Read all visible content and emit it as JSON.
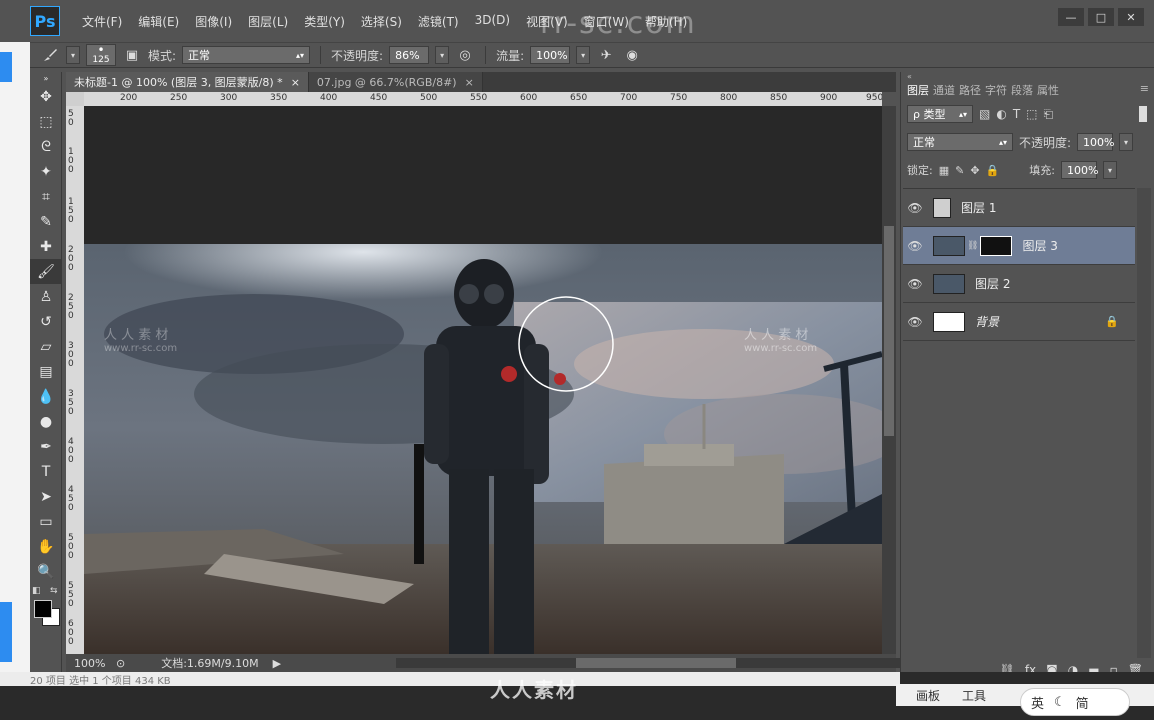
{
  "app": {
    "logo": "Ps",
    "menu": [
      "文件(F)",
      "编辑(E)",
      "图像(I)",
      "图层(L)",
      "类型(Y)",
      "选择(S)",
      "滤镜(T)",
      "3D(D)",
      "视图(V)",
      "窗口(W)",
      "帮助(H)"
    ],
    "window_controls": [
      "—",
      "□",
      "✕"
    ],
    "watermark": "rr-sc.com"
  },
  "options": {
    "brush_size": "125",
    "mode_label": "模式:",
    "mode_value": "正常",
    "opacity_label": "不透明度:",
    "opacity_value": "86%",
    "flow_label": "流量:",
    "flow_value": "100%"
  },
  "tabs": [
    {
      "label": "未标题-1 @ 100% (图层 3, 图层蒙版/8) *",
      "close": "×"
    },
    {
      "label": "07.jpg @ 66.7%(RGB/8#)",
      "close": "×"
    }
  ],
  "ruler": {
    "h_ticks": [
      "200",
      "250",
      "300",
      "350",
      "400",
      "450",
      "500",
      "550",
      "600",
      "650",
      "700",
      "750",
      "800",
      "850",
      "900",
      "950"
    ],
    "v_ticks": [
      "5\n0",
      "1\n0\n0",
      "1\n5\n0",
      "2\n0\n0",
      "2\n5\n0",
      "3\n0\n0",
      "3\n5\n0",
      "4\n0\n0",
      "4\n5\n0",
      "5\n0\n0",
      "5\n5\n0",
      "6\n0\n0"
    ]
  },
  "status": {
    "zoom": "100%",
    "doc": "文档:1.69M/9.10M"
  },
  "canvas": {
    "watermark_cn": "人 人 素 材",
    "watermark_url": "www.rr-sc.com"
  },
  "panel": {
    "tabs": [
      "图层",
      "通道",
      "路径",
      "字符",
      "段落",
      "属性"
    ],
    "filter_kind": "ρ 类型",
    "blend_mode": "正常",
    "opacity_label": "不透明度:",
    "opacity_value": "100%",
    "lock_label": "锁定:",
    "fill_label": "填充:",
    "fill_value": "100%",
    "layers": [
      {
        "name": "图层 1",
        "selected": false,
        "thumb_color": "#cfcfcf"
      },
      {
        "name": "图层 3",
        "selected": true,
        "thumb_color": "#4a5868"
      },
      {
        "name": "图层 2",
        "selected": false,
        "thumb_color": "#4a5868"
      },
      {
        "name": "背景",
        "selected": false,
        "thumb_color": "#ffffff"
      }
    ],
    "footer_icons": [
      "link-icon",
      "fx-icon",
      "mask-icon",
      "adjustment-icon",
      "folder-icon",
      "new-layer-icon",
      "trash-icon"
    ]
  },
  "bottom": {
    "left_text": "20 项目   选中 1 个项目  434 KB",
    "panel_tabs": [
      "画板",
      "工具"
    ],
    "ime": [
      "英",
      "☾",
      "简"
    ],
    "logo": "人人素材"
  }
}
